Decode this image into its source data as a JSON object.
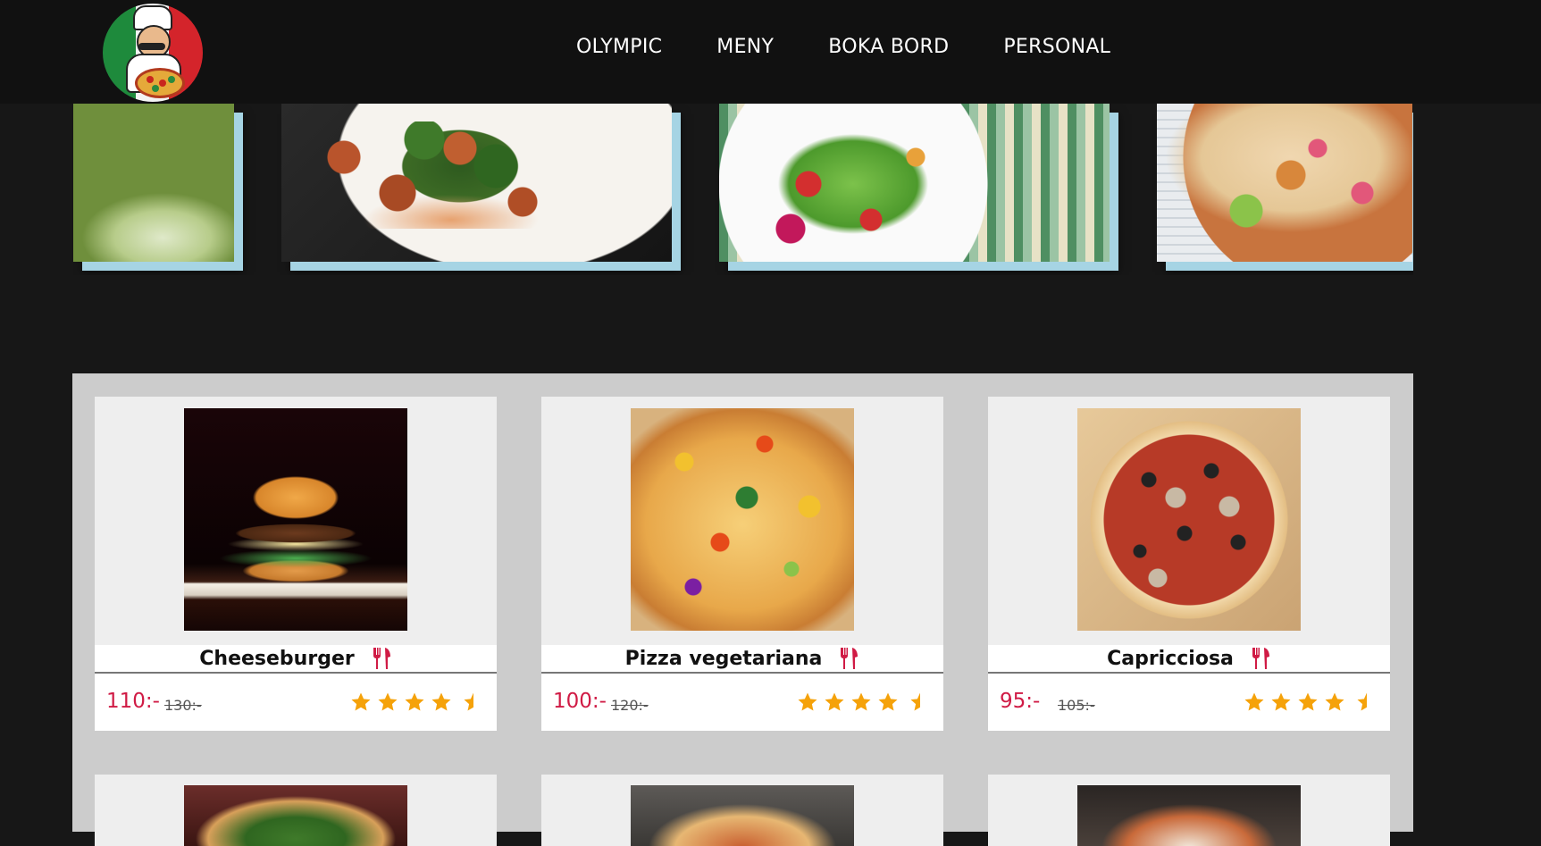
{
  "nav": {
    "items": [
      "OLYMPIC",
      "MENY",
      "BOKA BORD",
      "PERSONAL"
    ]
  },
  "logo": {
    "icon": "chef-pizza-logo"
  },
  "carousel": {
    "slides": [
      "fries-and-cucumber-photo",
      "chicken-spinach-plate-photo",
      "salad-bowl-photo",
      "tacos-photo"
    ]
  },
  "menu": {
    "items": [
      {
        "title": "Cheeseburger",
        "price": "110:-",
        "old_price": "130:-",
        "rating": 4.5,
        "photo": "cheeseburger-photo"
      },
      {
        "title": "Pizza vegetariana",
        "price": "100:-",
        "old_price": "120:-",
        "rating": 4.5,
        "photo": "vegetarian-pizza-photo"
      },
      {
        "title": "Capricciosa",
        "price": "95:-",
        "old_price": "105:-",
        "rating": 4.5,
        "photo": "capricciosa-pizza-photo"
      }
    ]
  },
  "colors": {
    "background": "#171717",
    "header": "#111111",
    "panel": "#cccccc",
    "card": "#eeeeee",
    "price": "#d01b45",
    "star": "#f5a20a",
    "fork_icon": "#d01b45",
    "carousel_shadow": "#a6d4e4"
  }
}
